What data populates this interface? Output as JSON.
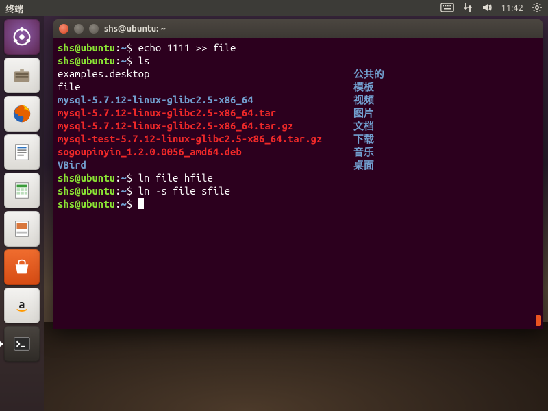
{
  "menubar": {
    "app_title": "终端",
    "clock": "11:42"
  },
  "launcher": {
    "items": [
      {
        "name": "dash",
        "label": "Dash"
      },
      {
        "name": "files",
        "label": "文件"
      },
      {
        "name": "firefox",
        "label": "Firefox"
      },
      {
        "name": "writer",
        "label": "LibreOffice Writer"
      },
      {
        "name": "calc",
        "label": "LibreOffice Calc"
      },
      {
        "name": "impress",
        "label": "LibreOffice Impress"
      },
      {
        "name": "software",
        "label": "Ubuntu 软件"
      },
      {
        "name": "amazon",
        "label": "Amazon"
      },
      {
        "name": "terminal",
        "label": "终端"
      }
    ]
  },
  "window": {
    "title": "shs@ubuntu: ~"
  },
  "prompt": {
    "user_host": "shs@ubuntu",
    "sep": ":",
    "path": "~",
    "dollar": "$"
  },
  "terminal": {
    "lines": [
      {
        "type": "cmd",
        "text": "echo 1111 >> file"
      },
      {
        "type": "cmd",
        "text": "ls"
      },
      {
        "type": "out",
        "cls": "c-white",
        "text": "examples.desktop"
      },
      {
        "type": "out",
        "cls": "c-white",
        "text": "file"
      },
      {
        "type": "out",
        "cls": "c-blue",
        "text": "mysql-5.7.12-linux-glibc2.5-x86_64"
      },
      {
        "type": "out",
        "cls": "c-red",
        "text": "mysql-5.7.12-linux-glibc2.5-x86_64.tar"
      },
      {
        "type": "out",
        "cls": "c-red",
        "text": "mysql-5.7.12-linux-glibc2.5-x86_64.tar.gz"
      },
      {
        "type": "out",
        "cls": "c-red",
        "text": "mysql-test-5.7.12-linux-glibc2.5-x86_64.tar.gz"
      },
      {
        "type": "out",
        "cls": "c-red",
        "text": "sogoupinyin_1.2.0.0056_amd64.deb"
      },
      {
        "type": "out",
        "cls": "c-blue",
        "text": "VBird"
      },
      {
        "type": "cmd",
        "text": "ln file hfile"
      },
      {
        "type": "cmd",
        "text": "ln -s file sfile"
      },
      {
        "type": "cmd",
        "text": ""
      }
    ],
    "right_col": [
      {
        "cls": "c-blue",
        "text": "公共的"
      },
      {
        "cls": "c-blue",
        "text": "模板"
      },
      {
        "cls": "c-blue",
        "text": "视频"
      },
      {
        "cls": "c-blue",
        "text": "图片"
      },
      {
        "cls": "c-blue",
        "text": "文档"
      },
      {
        "cls": "c-blue",
        "text": "下载"
      },
      {
        "cls": "c-blue",
        "text": "音乐"
      },
      {
        "cls": "c-blue",
        "text": "桌面"
      }
    ]
  }
}
